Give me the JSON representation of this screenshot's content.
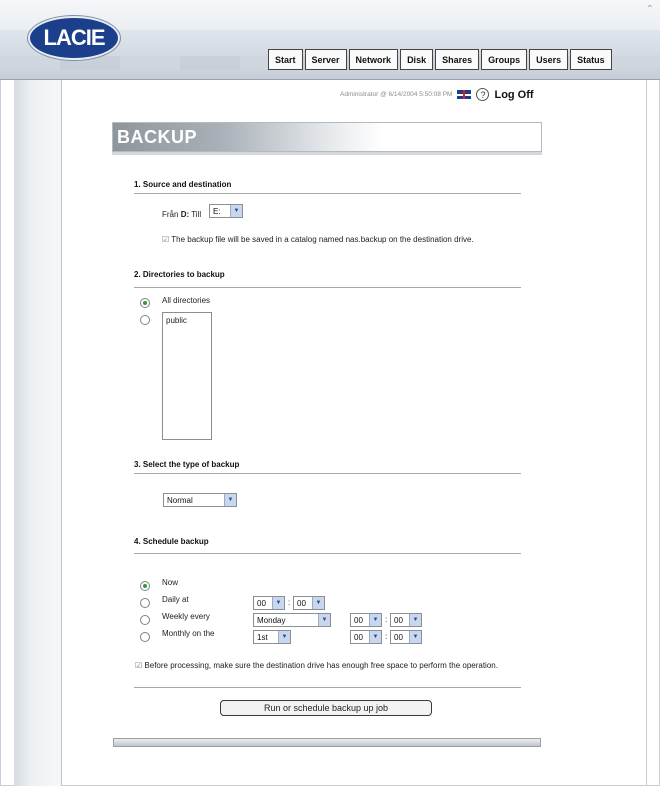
{
  "brand": {
    "logo_text": "LACIE"
  },
  "tabs": [
    "Start",
    "Server",
    "Network",
    "Disk",
    "Shares",
    "Groups",
    "Users",
    "Status"
  ],
  "userbar": {
    "user_info": "Administrator @ 6/14/2004 5:50:08 PM",
    "logoff_label": "Log Off"
  },
  "page_title": "BACKUP",
  "sections": {
    "source": {
      "title": "1. Source and destination",
      "from_label": "Från",
      "from_value": "D:",
      "to_label": "Till",
      "to_value": "E:",
      "note": "The backup file will be saved in a catalog named nas.backup on the destination drive."
    },
    "directories": {
      "title": "2. Directories to backup",
      "all_label": "All directories",
      "list_items": [
        "public"
      ]
    },
    "type": {
      "title": "3. Select the type of backup",
      "value": "Normal"
    },
    "schedule": {
      "title": "4. Schedule backup",
      "now_label": "Now",
      "daily_label": "Daily at",
      "weekly_label": "Weekly every",
      "monthly_label": "Monthly on the",
      "daily_hour": "00",
      "daily_min": "00",
      "weekly_day": "Monday",
      "weekly_hour": "00",
      "weekly_min": "00",
      "monthly_day": "1st",
      "monthly_hour": "00",
      "monthly_min": "00",
      "note": "Before processing, make sure the destination drive has enough free space to perform the operation.",
      "run_label": "Run or schedule backup up job"
    }
  },
  "colors": {
    "logo_bg": "#1c3f8c",
    "radio_checked": "#2d9a3a",
    "select_arrow_bg": "#c9d7ee"
  }
}
